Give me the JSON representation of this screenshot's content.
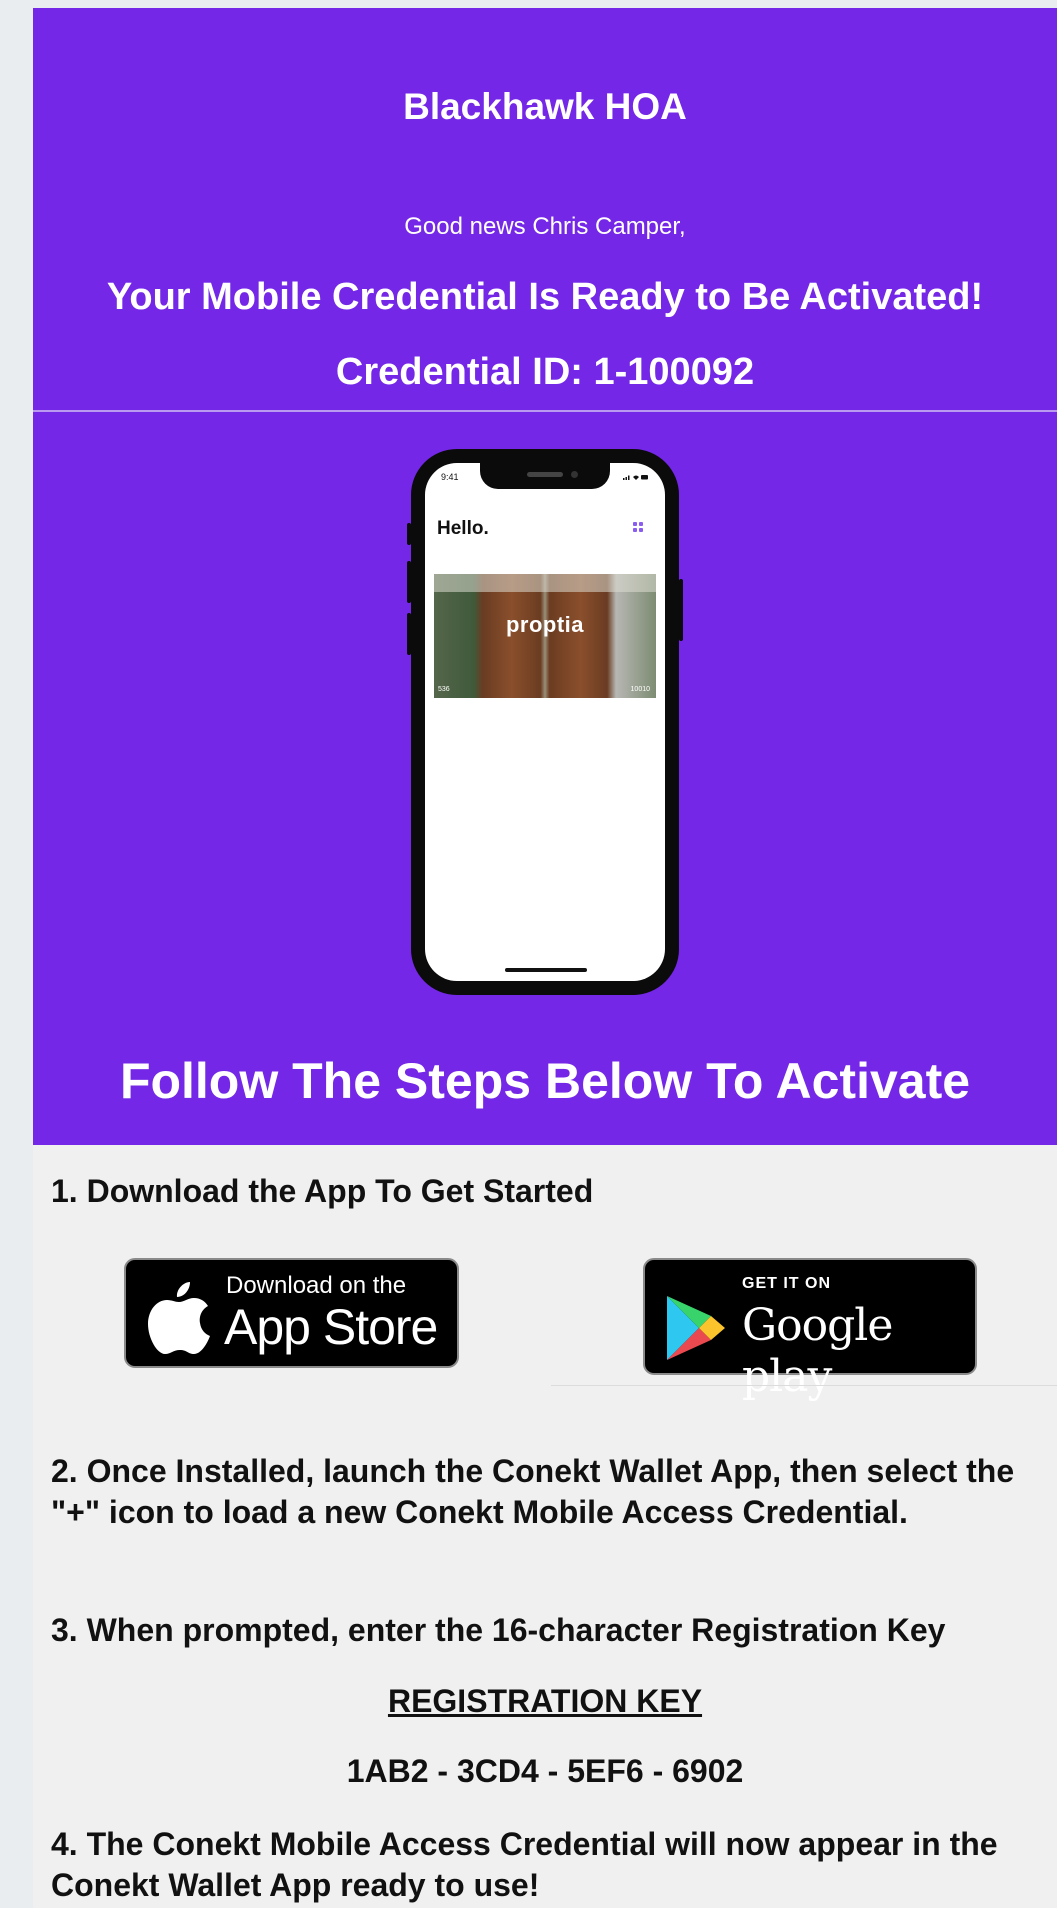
{
  "colors": {
    "hero_bg": "#7427e6",
    "text_on_hero": "#ffffff",
    "body_bg": "#f0f0f0",
    "store_btn_bg": "#000000"
  },
  "header": {
    "org_name": "Blackhawk HOA",
    "greeting": "Good news Chris Camper,",
    "headline": "Your Mobile Credential Is Ready to Be Activated!",
    "credential_id": "Credential ID: 1-100092"
  },
  "phone_mockup": {
    "time": "9:41",
    "greeting": "Hello.",
    "brand": "proptia",
    "card_left": "536",
    "card_right": "10010"
  },
  "steps_heading": "Follow The Steps Below To Activate",
  "steps": {
    "step1": "1. Download the App To Get Started",
    "step2": "2. Once Installed, launch the Conekt Wallet App,  then select  the \"+\" icon to load a new Conekt Mobile Access Credential.",
    "step3": "3. When prompted, enter the 16-character Registration Key",
    "step4": "4. The Conekt Mobile Access Credential will now appear in the  Conekt Wallet App ready to use!"
  },
  "store_buttons": {
    "app_store": {
      "small": "Download on the",
      "big": "App Store",
      "icon": "apple-icon"
    },
    "google_play": {
      "small": "GET IT ON",
      "big": "Google play",
      "icon": "google-play-icon"
    }
  },
  "registration": {
    "label": "REGISTRATION KEY",
    "key": "1AB2 - 3CD4 - 5EF6 - 6902"
  }
}
